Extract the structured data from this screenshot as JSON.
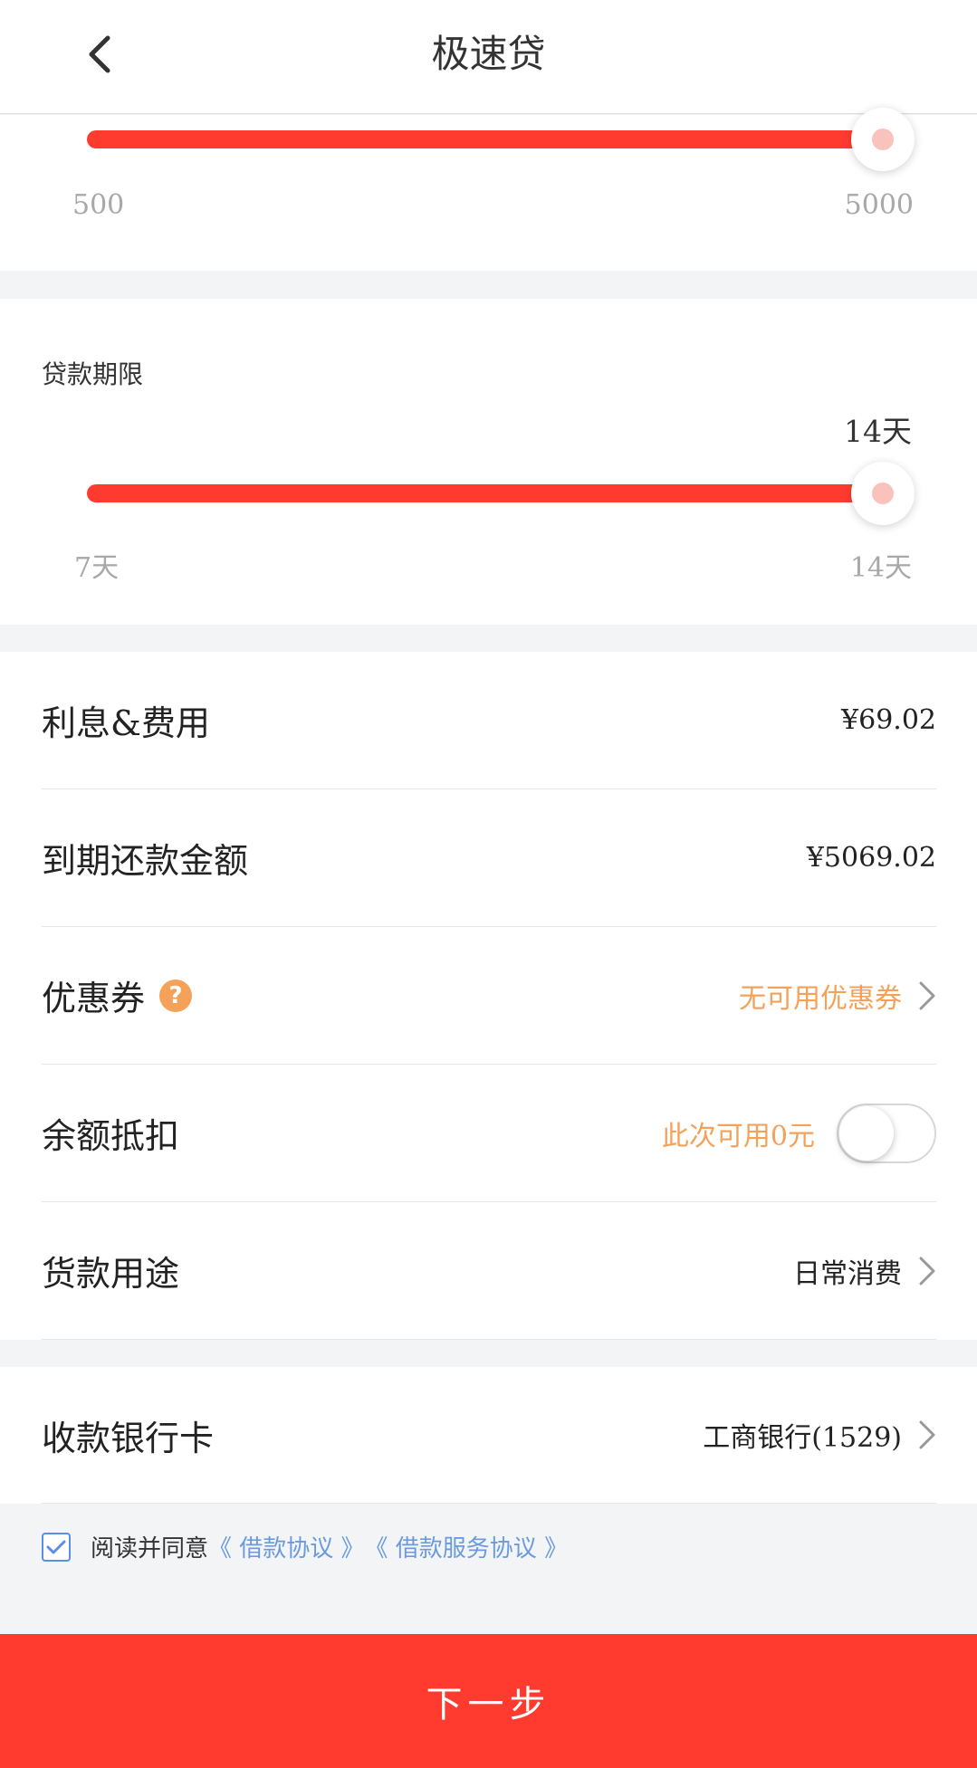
{
  "header": {
    "title": "极速贷"
  },
  "amount_slider": {
    "min_label": "500",
    "max_label": "5000",
    "min": 500,
    "max": 5000,
    "value": 5000
  },
  "term_slider": {
    "label": "贷款期限",
    "current_label": "14天",
    "min_label": "7天",
    "max_label": "14天",
    "min": 7,
    "max": 14,
    "value": 14
  },
  "details": {
    "interest": {
      "label": "利息&费用",
      "value": "¥69.02"
    },
    "repayment": {
      "label": "到期还款金额",
      "value": "¥5069.02"
    },
    "coupon": {
      "label": "优惠券",
      "value": "无可用优惠券"
    },
    "balance": {
      "label": "余额抵扣",
      "value": "此次可用0元",
      "enabled": false
    },
    "purpose": {
      "label": "货款用途",
      "value": "日常消费"
    }
  },
  "bank": {
    "label": "收款银行卡",
    "value": "工商银行(1529)"
  },
  "agreement": {
    "checked": true,
    "prefix": "阅读并同意",
    "link1": "《 借款协议 》",
    "link2": "《 借款服务协议 》"
  },
  "footer": {
    "next_label": "下一步"
  },
  "colors": {
    "accent": "#ff3b30",
    "orange": "#f4a259",
    "link": "#6a9be0"
  }
}
